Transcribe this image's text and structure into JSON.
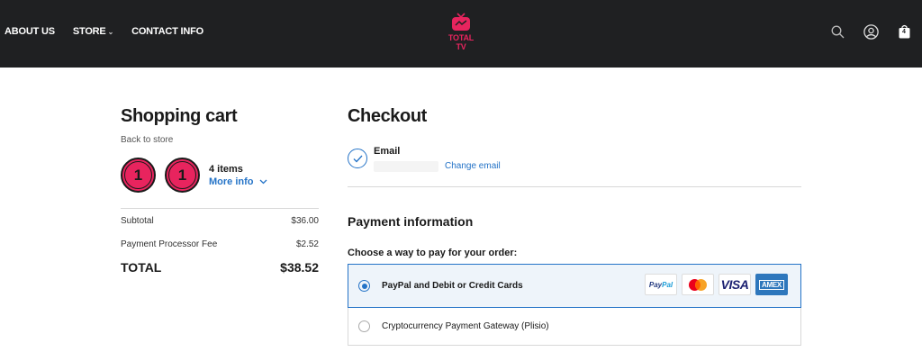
{
  "nav": {
    "about": "ABOUT US",
    "store": "STORE",
    "contact": "CONTACT INFO"
  },
  "brand": {
    "name": "TOTAL TV",
    "color": "#e8245e"
  },
  "header_icons": {
    "search": "search-icon",
    "account": "user-icon",
    "bag": "shopping-bag-icon",
    "bag_count": "4"
  },
  "cart": {
    "title": "Shopping cart",
    "back_link": "Back to store",
    "badge_number": "1",
    "items_count": "4 items",
    "more_info": "More info",
    "subtotal_label": "Subtotal",
    "subtotal_value": "$36.00",
    "fee_label": "Payment Processor Fee",
    "fee_value": "$2.52",
    "total_label": "TOTAL",
    "total_value": "$38.52"
  },
  "checkout": {
    "title": "Checkout",
    "email_label": "Email",
    "change_email": "Change email",
    "payment_title": "Payment information",
    "choose_label": "Choose a way to pay for your order:",
    "options": [
      {
        "label": "PayPal and Debit or Credit Cards",
        "selected": true
      },
      {
        "label": "Cryptocurrency Payment Gateway (Plisio)",
        "selected": false
      }
    ],
    "cards": [
      "PayPal",
      "Mastercard",
      "VISA",
      "AMEX"
    ]
  },
  "colors": {
    "accent": "#2473c7",
    "topbar": "#1f2022"
  }
}
